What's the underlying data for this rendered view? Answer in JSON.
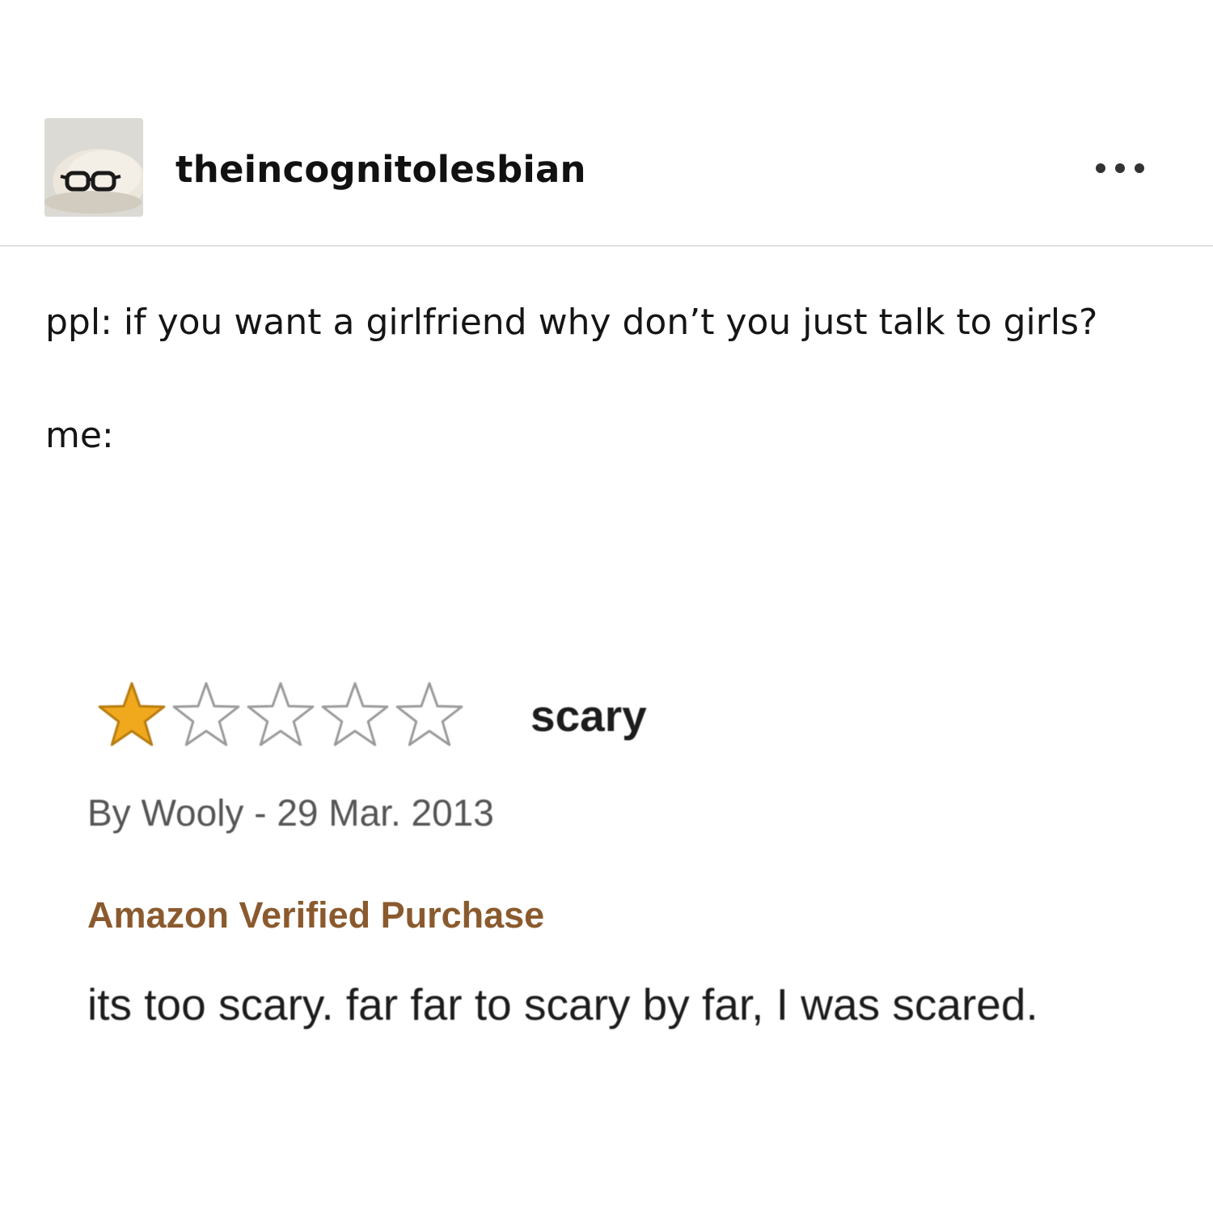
{
  "post": {
    "username": "theincognitolesbian",
    "avatar_icon": "plush-with-glasses-avatar",
    "more_icon": "more-options-icon",
    "body_line1": "ppl: if you want a girlfriend why don’t you just talk to girls?",
    "body_line2": "me:"
  },
  "review": {
    "rating": 1,
    "rating_max": 5,
    "star_color": "#f0a81c",
    "title": "scary",
    "byline": "By Wooly - 29 Mar. 2013",
    "verified_label": "Amazon Verified Purchase",
    "verified_color": "#8a5a2e",
    "text": "its too scary. far far to scary by far, I was scared."
  }
}
